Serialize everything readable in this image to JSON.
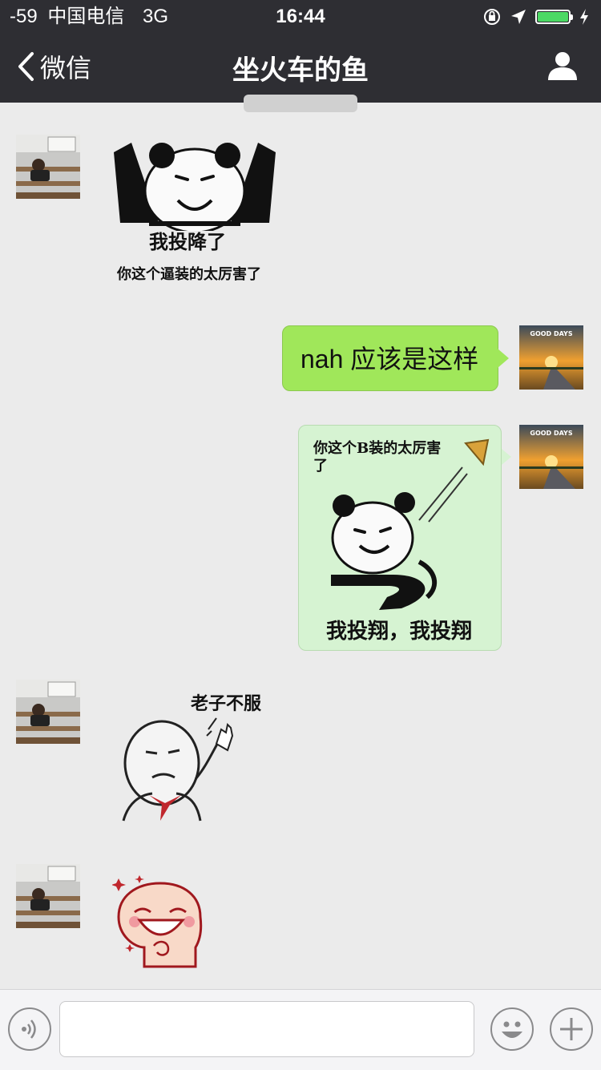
{
  "status_bar": {
    "signal": "-59",
    "carrier": "中国电信",
    "network": "3G",
    "time": "16:44",
    "battery_level": 1.0,
    "battery_color": "#4cd964"
  },
  "nav": {
    "back_label": "微信",
    "title": "坐火车的鱼",
    "profile_icon": "person-icon"
  },
  "messages": [
    {
      "from": "them",
      "type": "sticker",
      "caption_main": "我投降了",
      "caption_sub": "你这个逼装的太厉害了"
    },
    {
      "from": "me",
      "type": "text",
      "text": "nah 应该是这样"
    },
    {
      "from": "me",
      "type": "sticker",
      "caption_top": "你这个B装的太厉害了",
      "caption_bottom": "我投翔，我投翔"
    },
    {
      "from": "them",
      "type": "sticker",
      "caption": "老子不服"
    },
    {
      "from": "them",
      "type": "sticker",
      "caption": ""
    }
  ],
  "avatars": {
    "me_badge": "GOOD DAYS"
  },
  "input_bar": {
    "voice_icon": "voice-icon",
    "emoji_icon": "emoji-icon",
    "plus_icon": "plus-icon",
    "value": ""
  },
  "colors": {
    "header": "#2e2e33",
    "chat_bg": "#ebebeb",
    "my_bubble": "#a0e75a"
  }
}
